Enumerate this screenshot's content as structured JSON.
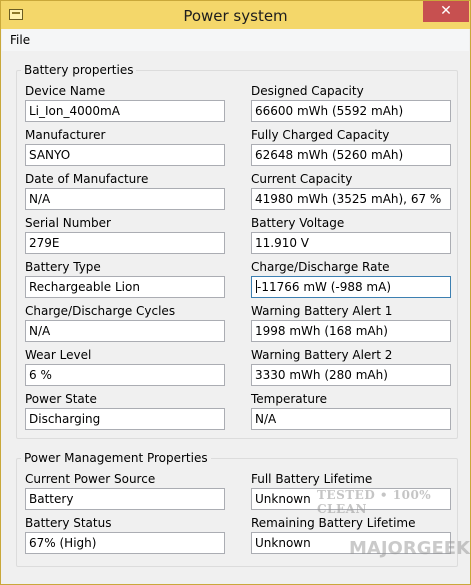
{
  "window": {
    "title": "Power system",
    "close_glyph": "✕",
    "icon": "app-window-icon"
  },
  "menu": {
    "file": "File"
  },
  "battery_group": {
    "legend": "Battery properties",
    "device_name": {
      "label": "Device Name",
      "value": "Li_Ion_4000mA"
    },
    "manufacturer": {
      "label": "Manufacturer",
      "value": "SANYO"
    },
    "date_of_manufacture": {
      "label": "Date of Manufacture",
      "value": "N/A"
    },
    "serial_number": {
      "label": "Serial Number",
      "value": "279E"
    },
    "battery_type": {
      "label": "Battery Type",
      "value": "Rechargeable Lion"
    },
    "cycles": {
      "label": "Charge/Discharge Cycles",
      "value": "N/A"
    },
    "wear_level": {
      "label": "Wear Level",
      "value": "6 %"
    },
    "power_state": {
      "label": "Power State",
      "value": "Discharging"
    },
    "designed_capacity": {
      "label": "Designed Capacity",
      "value": "66600 mWh (5592 mAh)"
    },
    "full_capacity": {
      "label": "Fully Charged Capacity",
      "value": "62648 mWh (5260 mAh)"
    },
    "current_capacity": {
      "label": "Current Capacity",
      "value": "41980 mWh (3525 mAh), 67 %"
    },
    "voltage": {
      "label": "Battery Voltage",
      "value": "11.910 V"
    },
    "rate": {
      "label": "Charge/Discharge Rate",
      "value": "-11766 mW (-988 mA)"
    },
    "alert1": {
      "label": "Warning Battery Alert 1",
      "value": "1998 mWh (168 mAh)"
    },
    "alert2": {
      "label": "Warning Battery Alert 2",
      "value": "3330 mWh (280 mAh)"
    },
    "temperature": {
      "label": "Temperature",
      "value": "N/A"
    }
  },
  "power_group": {
    "legend": "Power Management Properties",
    "power_source": {
      "label": "Current Power Source",
      "value": "Battery"
    },
    "battery_status": {
      "label": "Battery Status",
      "value": "67% (High)"
    },
    "full_lifetime": {
      "label": "Full Battery Lifetime",
      "value": "Unknown"
    },
    "remaining_lifetime": {
      "label": "Remaining Battery Lifetime",
      "value": "Unknown"
    }
  },
  "watermark": {
    "line1": "TESTED • 100% CLEAN",
    "line2": "MAJORGEEKS"
  }
}
